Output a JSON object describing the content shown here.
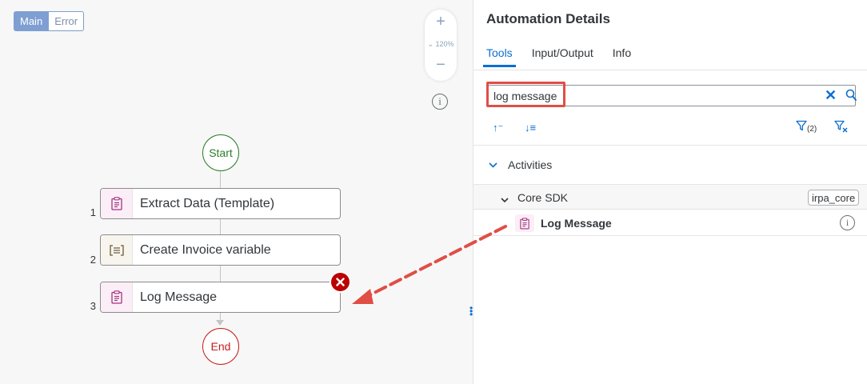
{
  "canvas": {
    "segments": [
      {
        "label": "Main",
        "active": true
      },
      {
        "label": "Error",
        "active": false
      }
    ],
    "zoom": {
      "plus": "+",
      "level": "120%",
      "minus": "−"
    },
    "info_glyph": "i",
    "start_label": "Start",
    "end_label": "End",
    "steps": [
      {
        "number": "1",
        "label": "Extract Data (Template)",
        "icon": "clipboard-icon"
      },
      {
        "number": "2",
        "label": "Create Invoice variable",
        "icon": "variable-icon"
      },
      {
        "number": "3",
        "label": "Log Message",
        "icon": "clipboard-icon",
        "error": true
      }
    ]
  },
  "panel": {
    "title": "Automation Details",
    "tabs": [
      {
        "label": "Tools",
        "selected": true
      },
      {
        "label": "Input/Output",
        "selected": false
      },
      {
        "label": "Info",
        "selected": false
      }
    ],
    "search": {
      "value": "log message",
      "clear": "✕"
    },
    "toolbar": {
      "sort_asc": "↑⁻",
      "sort_desc": "↓≡",
      "filter_count": "(2)"
    },
    "tree": {
      "group_label": "Activities",
      "subgroup_label": "Core SDK",
      "package_tag": "irpa_core",
      "item_label": "Log Message",
      "item_info": "i"
    }
  },
  "colors": {
    "accent": "#0a6ed1",
    "start_green": "#2b7c2b",
    "end_red": "#c81d1d",
    "error_red": "#bb0000",
    "highlight_red": "#e04e45"
  }
}
